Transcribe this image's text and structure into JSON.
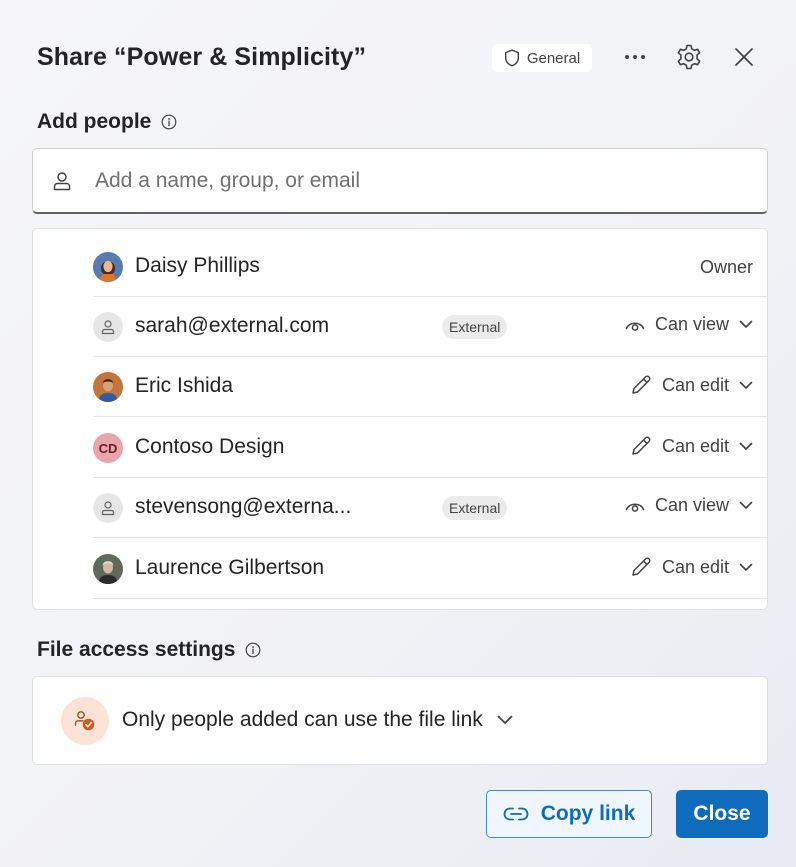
{
  "header": {
    "title": "Share “Power & Simplicity”",
    "sensitivity_label": "General",
    "sensitivity_icon": "shield-icon",
    "more_icon": "more-horizontal-icon",
    "settings_icon": "gear-icon",
    "close_icon": "close-icon"
  },
  "add_people": {
    "label": "Add people",
    "info_icon": "info-icon",
    "input_placeholder": "Add a name, group, or email",
    "input_value": ""
  },
  "people": [
    {
      "name": "Daisy Phillips",
      "avatar": "photo",
      "role": "Owner"
    },
    {
      "name": "sarah@external.com",
      "avatar": "generic-person",
      "tag": "External",
      "permission": "Can view",
      "permission_icon": "eye-icon"
    },
    {
      "name": "Eric Ishida",
      "avatar": "photo",
      "permission": "Can edit",
      "permission_icon": "pencil-icon"
    },
    {
      "name": "Contoso Design",
      "avatar": "initials",
      "initials": "CD",
      "permission": "Can edit",
      "permission_icon": "pencil-icon"
    },
    {
      "name": "stevensong@externa...",
      "avatar": "generic-person",
      "tag": "External",
      "permission": "Can view",
      "permission_icon": "eye-icon"
    },
    {
      "name": "Laurence Gilbertson",
      "avatar": "photo",
      "permission": "Can edit",
      "permission_icon": "pencil-icon"
    }
  ],
  "file_access": {
    "label": "File access settings",
    "info_icon": "info-icon",
    "setting": "Only people added can use the file link",
    "setting_icon": "people-check-icon"
  },
  "footer": {
    "copy_link_label": "Copy link",
    "copy_link_icon": "link-icon",
    "close_label": "Close"
  },
  "colors": {
    "accent": "#0f6cbd",
    "initials_avatar_bg": "#e8a5ab",
    "access_icon_bg": "#fde3d6",
    "access_icon_fg": "#d05a1d"
  }
}
